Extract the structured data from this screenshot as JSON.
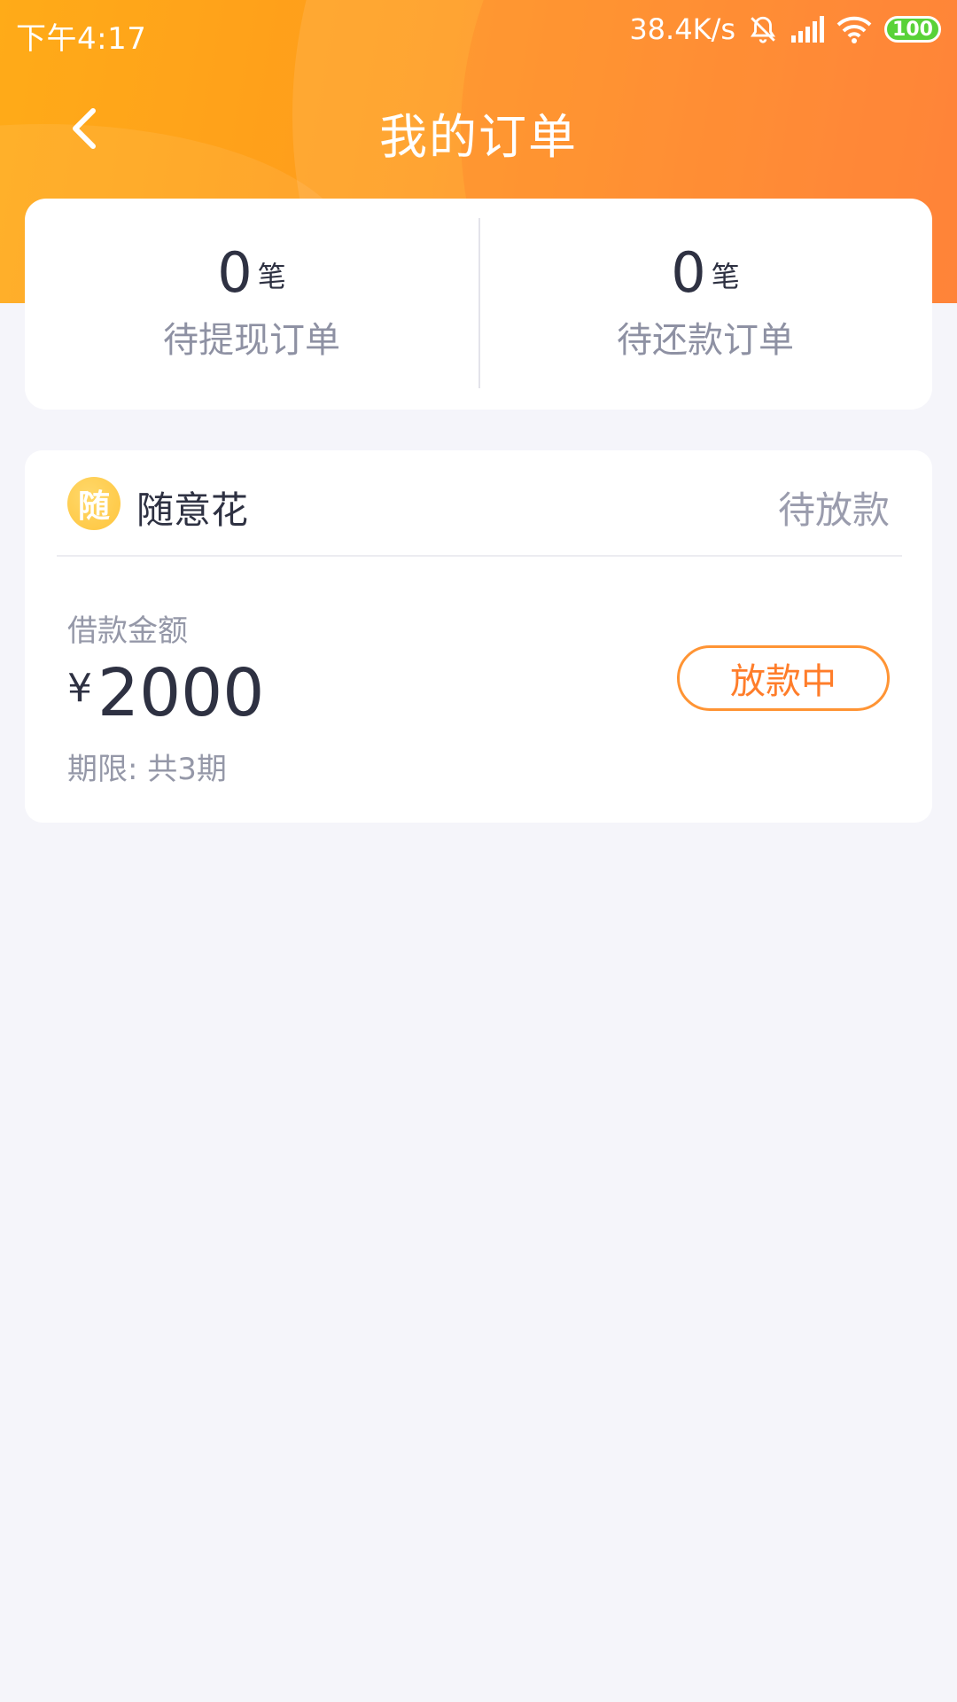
{
  "status_bar": {
    "time": "下午4:17",
    "net_speed": "38.4K/s",
    "battery": "100",
    "icons": [
      "alarm-off-icon",
      "signal-icon",
      "wifi-icon",
      "battery-icon"
    ]
  },
  "nav": {
    "title": "我的订单",
    "back_icon": "chevron-left-icon"
  },
  "summary": {
    "withdraw_count": "0",
    "withdraw_unit": "笔",
    "withdraw_label": "待提现订单",
    "repay_count": "0",
    "repay_unit": "笔",
    "repay_label": "待还款订单"
  },
  "order": {
    "logo_char": "随",
    "brand_name": "随意花",
    "status": "待放款",
    "amount_label": "借款金额",
    "currency": "¥",
    "amount": "2000",
    "term": "期限: 共3期",
    "button_label": "放款中"
  },
  "colors": {
    "header_start": "#ffab18",
    "header_end": "#ff7a2a",
    "accent": "#ff7d2a",
    "text_primary": "#2e3142",
    "text_secondary": "#8e91a3",
    "battery_green": "#59d238"
  }
}
